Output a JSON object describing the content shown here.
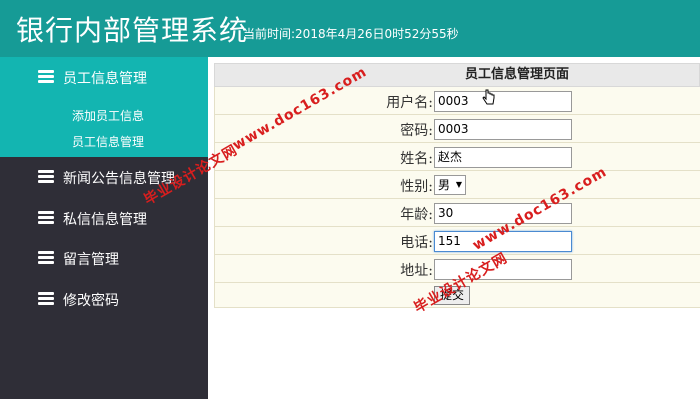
{
  "app": {
    "title": "银行内部管理系统",
    "time": "当前时间:2018年4月26日0时52分55秒"
  },
  "sidebar": {
    "items": [
      {
        "label": "员工信息管理"
      },
      {
        "label": "新闻公告信息管理"
      },
      {
        "label": "私信信息管理"
      },
      {
        "label": "留言管理"
      },
      {
        "label": "修改密码"
      }
    ],
    "submenu": [
      {
        "label": "添加员工信息"
      },
      {
        "label": "员工信息管理"
      }
    ]
  },
  "panel": {
    "title": "员工信息管理页面",
    "fields": [
      {
        "label": "用户名:",
        "value": "0003"
      },
      {
        "label": "密码:",
        "value": "0003"
      },
      {
        "label": "姓名:",
        "value": "赵杰"
      },
      {
        "label": "性别:",
        "value": "男"
      },
      {
        "label": "年龄:",
        "value": "30"
      },
      {
        "label": "电话:",
        "value": "151"
      },
      {
        "label": "地址:",
        "value": ""
      }
    ],
    "submit_label": "提交"
  },
  "watermark": {
    "cn": "毕业设计论文网",
    "url": "www.doc163.com"
  },
  "colors": {
    "header": "#169b96",
    "active": "#13b5b1",
    "sidebar": "#2f2e37"
  }
}
